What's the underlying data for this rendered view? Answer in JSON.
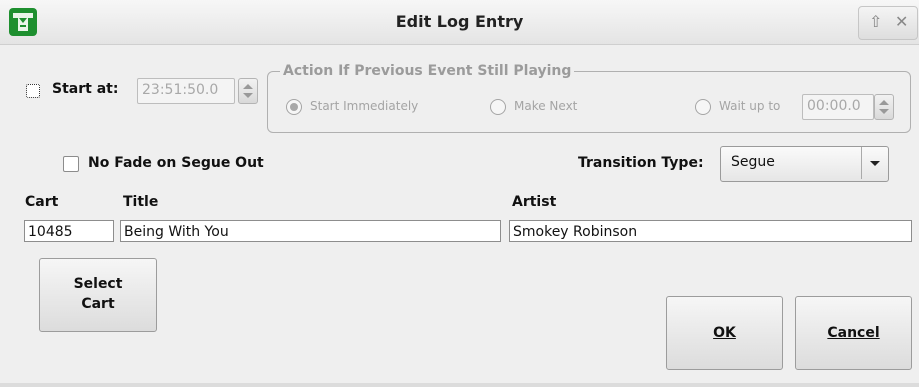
{
  "window": {
    "title": "Edit Log Entry",
    "app_icon": "rivendell-icon",
    "controls": [
      "maximize-icon",
      "close-icon"
    ]
  },
  "start_at": {
    "label": "Start at:",
    "checked": false,
    "time_value": "23:51:50.0",
    "enabled": false
  },
  "action_group": {
    "title": "Action If Previous Event Still Playing",
    "options": [
      {
        "label": "Start Immediately",
        "selected": true
      },
      {
        "label": "Make Next",
        "selected": false
      },
      {
        "label": "Wait up to",
        "selected": false
      }
    ],
    "wait_value": "00:00.0"
  },
  "no_fade": {
    "label": "No Fade on Segue Out",
    "checked": false
  },
  "transition": {
    "label": "Transition Type:",
    "value": "Segue"
  },
  "fields": {
    "cart_label": "Cart",
    "cart_value": "10485",
    "title_label": "Title",
    "title_value": "Being With You",
    "artist_label": "Artist",
    "artist_value": "Smokey Robinson"
  },
  "buttons": {
    "select_cart_line1": "Select",
    "select_cart_line2": "Cart",
    "ok_label": "OK",
    "cancel_label": "Cancel"
  }
}
